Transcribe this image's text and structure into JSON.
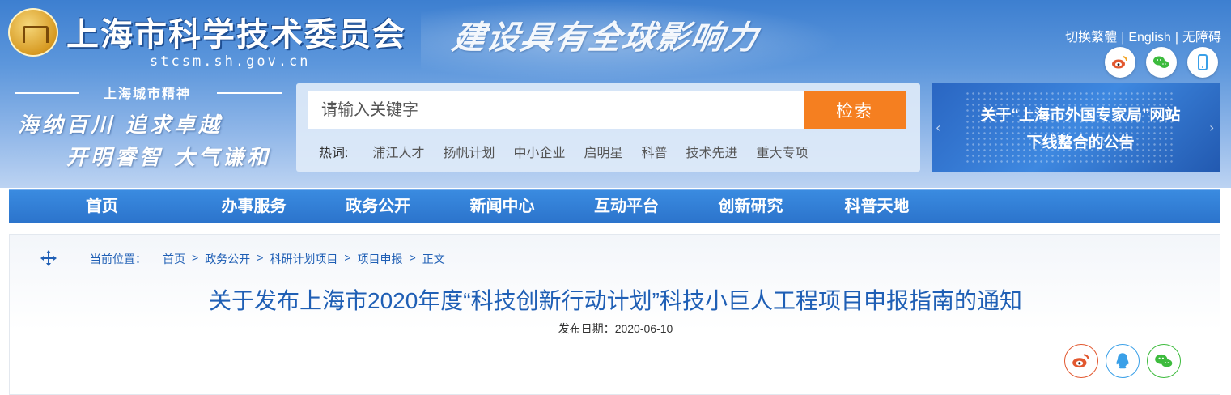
{
  "header": {
    "site_title": "上海市科学技术委员会",
    "site_domain": "stcsm.sh.gov.cn",
    "slogan": "建设具有全球影响力",
    "spirit": {
      "title": "上海城市精神",
      "line1": "海纳百川  追求卓越",
      "line2": "开明睿智  大气谦和"
    },
    "top_links": [
      "切换繁體",
      "English",
      "无障碍"
    ],
    "social_icons": [
      "weibo-icon",
      "wechat-icon",
      "mobile-icon"
    ]
  },
  "search": {
    "placeholder": "请输入关键字",
    "button_label": "检索",
    "hot_label": "热词:",
    "hot_words": [
      "浦江人才",
      "扬帆计划",
      "中小企业",
      "启明星",
      "科普",
      "技术先进",
      "重大专项"
    ]
  },
  "notice": {
    "line1": "关于“上海市外国专家局”网站",
    "line2": "下线整合的公告"
  },
  "nav": {
    "items": [
      "首页",
      "办事服务",
      "政务公开",
      "新闻中心",
      "互动平台",
      "创新研究",
      "科普天地"
    ]
  },
  "breadcrumb": {
    "label": "当前位置：",
    "items": [
      "首页",
      "政务公开",
      "科研计划项目",
      "项目申报",
      "正文"
    ],
    "separator": ">"
  },
  "article": {
    "title": "关于发布上海市2020年度“科技创新行动计划”科技小巨人工程项目申报指南的通知",
    "publish_label": "发布日期：",
    "publish_date": "2020-06-10"
  },
  "share": {
    "icons": [
      "weibo-icon",
      "qq-icon",
      "wechat-icon"
    ]
  },
  "colors": {
    "accent_blue": "#1f5fb5",
    "nav_blue": "#2c74cc",
    "search_orange": "#f57f20",
    "weibo_red": "#e2582f",
    "qq_blue": "#3aa0e8",
    "wechat_green": "#3dbb3d"
  }
}
